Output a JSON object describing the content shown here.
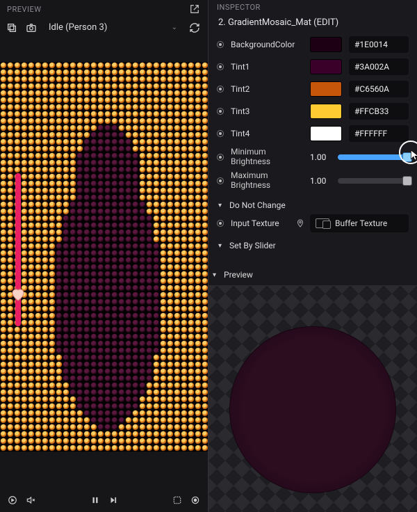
{
  "left": {
    "header": "PREVIEW",
    "state_label": "Idle (Person 3)",
    "icons": {
      "layers": "layers-icon",
      "camera": "camera-icon",
      "external": "external-link-icon",
      "refresh": "refresh-icon"
    },
    "bottom": {
      "music": "music-icon",
      "mute": "mute-icon",
      "pause": "pause-icon",
      "next": "next-icon",
      "crop": "crop-icon",
      "record": "record-icon"
    }
  },
  "right": {
    "header": "INSPECTOR",
    "subtitle": "2. GradientMosaic_Mat (EDIT)",
    "colors": [
      {
        "label": "BackgroundColor",
        "swatch": "#1E0014",
        "hex": "#1E0014"
      },
      {
        "label": "Tint1",
        "swatch": "#3A002A",
        "hex": "#3A002A"
      },
      {
        "label": "Tint2",
        "swatch": "#C6560A",
        "hex": "#C6560A"
      },
      {
        "label": "Tint3",
        "swatch": "#FFCB33",
        "hex": "#FFCB33"
      },
      {
        "label": "Tint4",
        "swatch": "#FFFFFF",
        "hex": "#FFFFFF"
      }
    ],
    "sliders": {
      "min_label": "Minimum Brightness",
      "min_value": "1.00",
      "min_pct": 100,
      "max_label": "Maximum Brightness",
      "max_value": "1.00",
      "max_pct": 100
    },
    "sections": {
      "dnc": "Do Not Change",
      "input_tex": "Input Texture",
      "tex_value": "Buffer Texture",
      "sbs": "Set By Slider",
      "preview": "Preview"
    }
  }
}
